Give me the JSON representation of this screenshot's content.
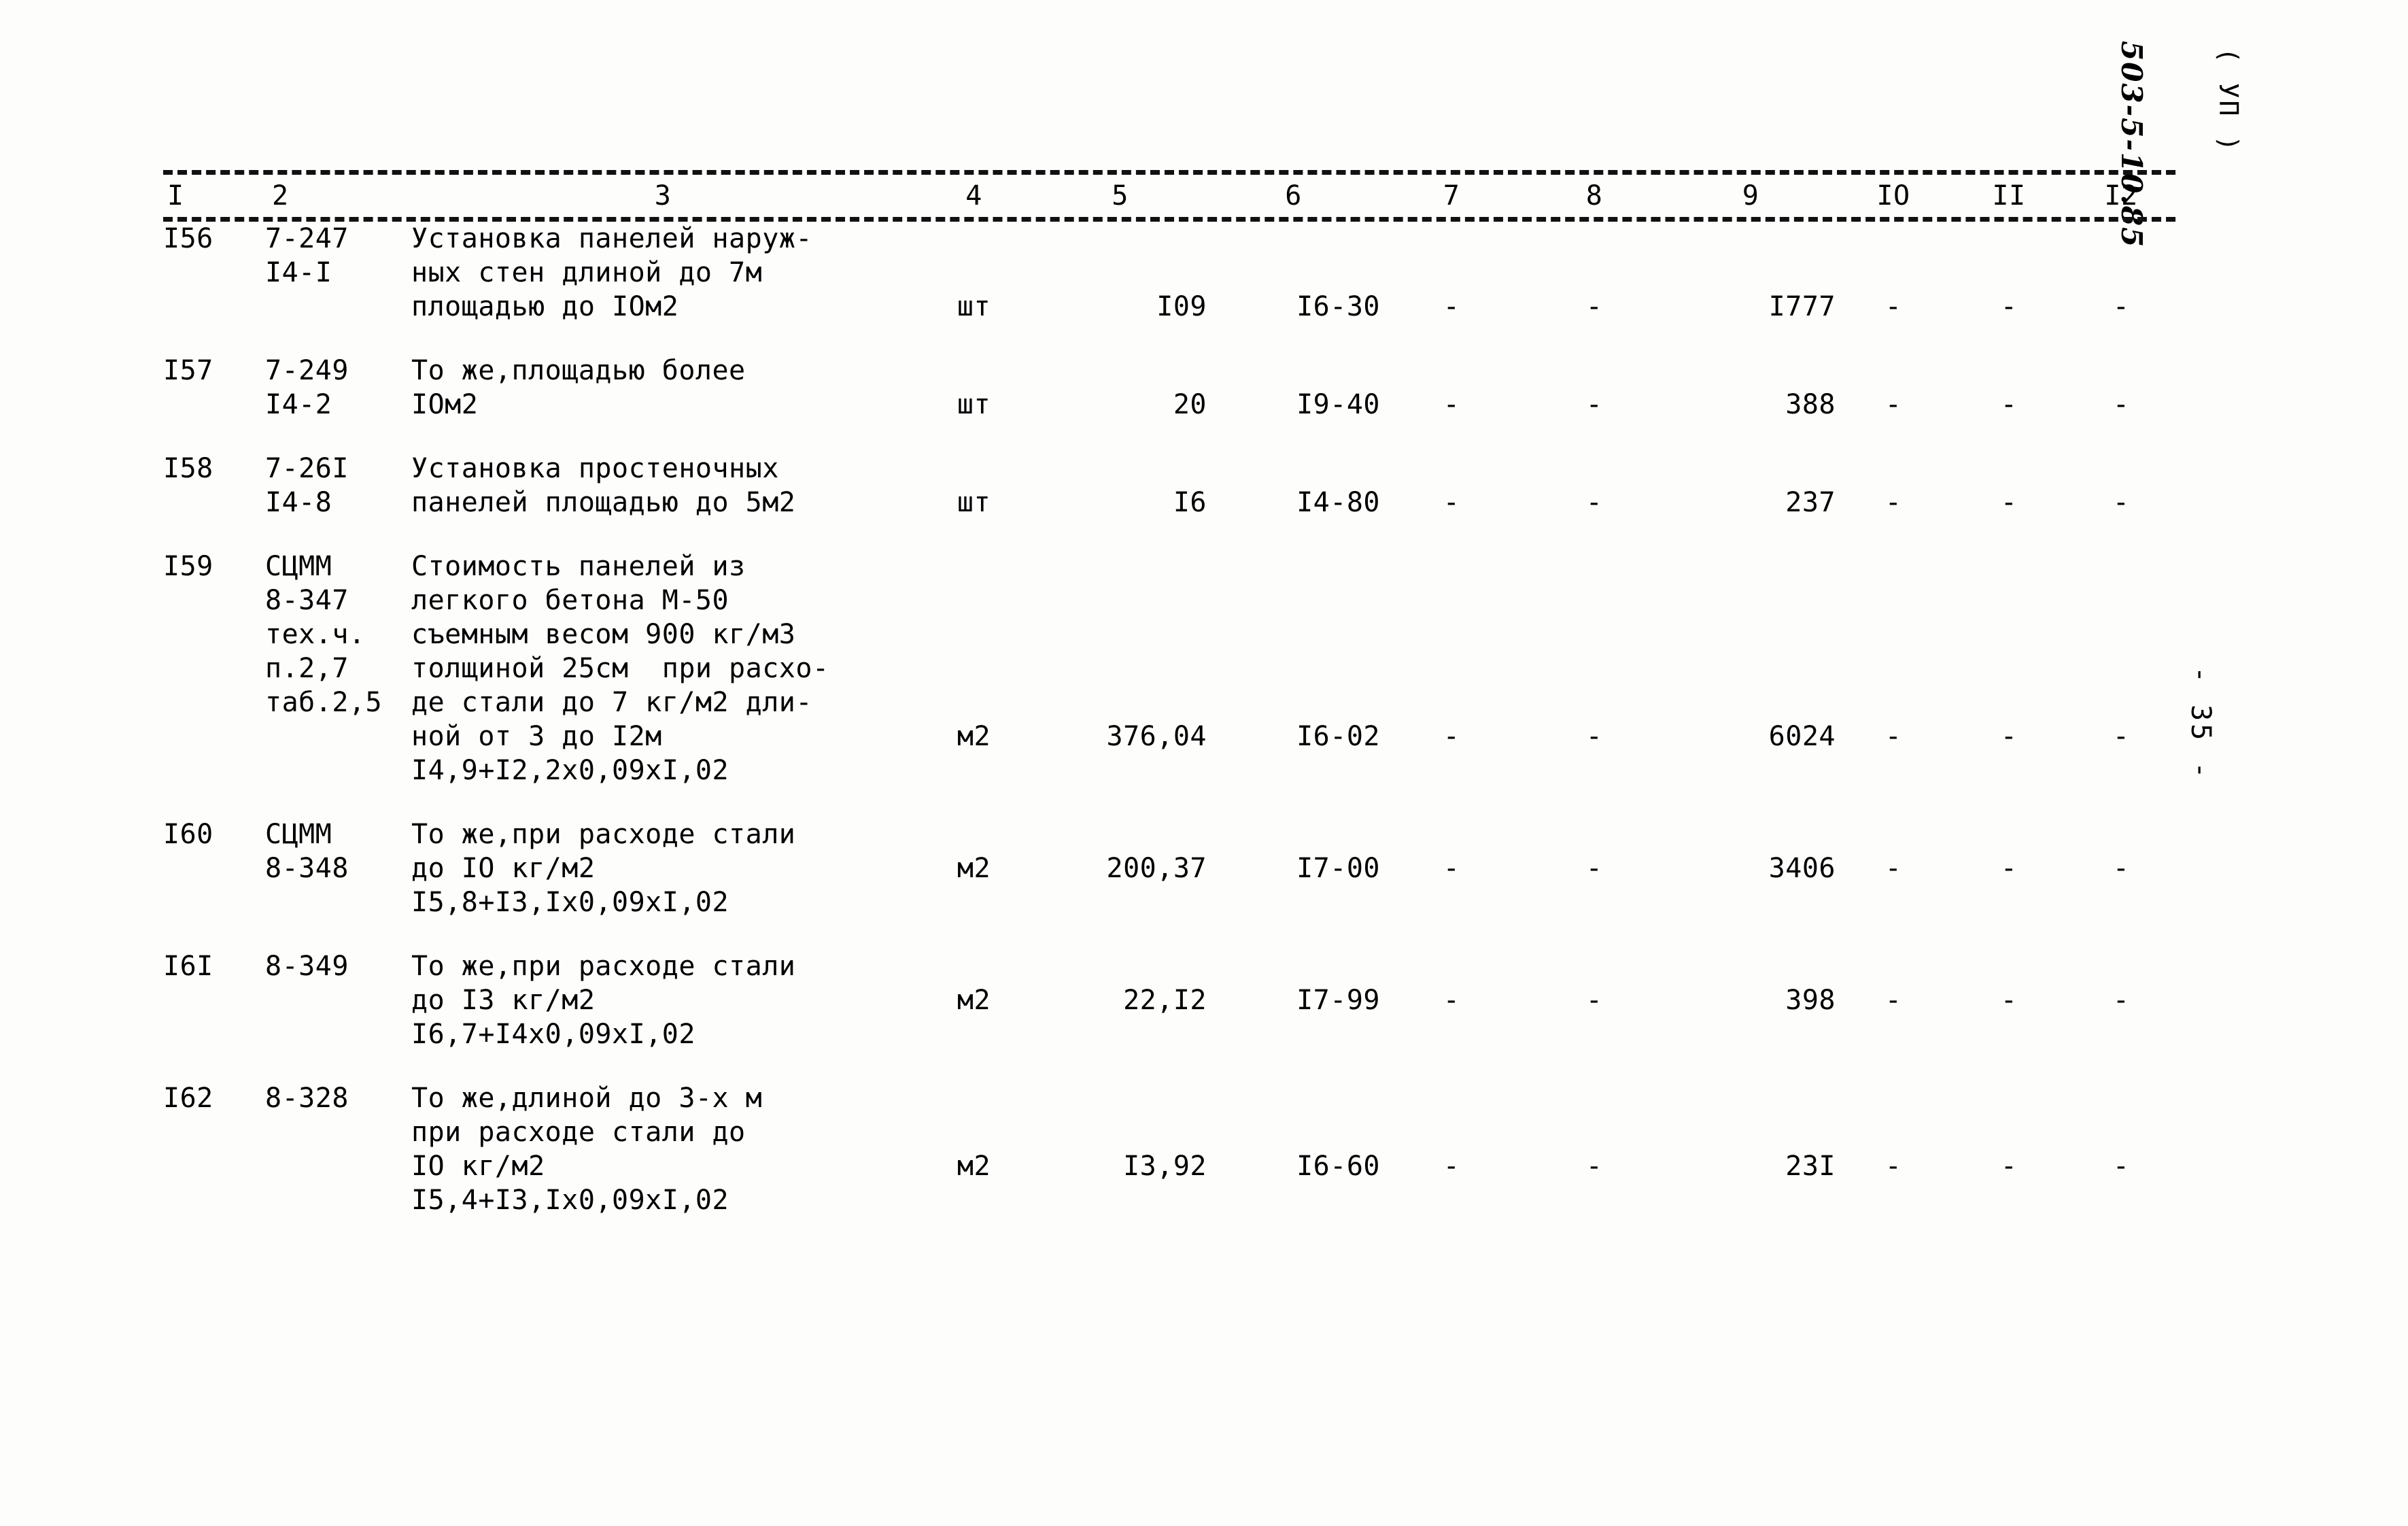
{
  "margin": {
    "document_code": "503-5-10.85",
    "variant": "( УП )",
    "page_number": "- 35 -"
  },
  "table": {
    "column_headers": [
      "I",
      "2",
      "3",
      "4",
      "5",
      "6",
      "7",
      "8",
      "9",
      "IO",
      "II",
      "I2"
    ],
    "rows": [
      {
        "num": "I56",
        "code": "7-247\nI4-I",
        "desc": "Установка панелей наруж-\nных стен длиной до 7м\nплощадью до IOм2",
        "unit": "шт",
        "qty": "I09",
        "price": "I6-30",
        "c7": "-",
        "c8": "-",
        "total": "I777",
        "c10": "-",
        "c11": "-",
        "c12": "-",
        "formula": "",
        "desc_lines_before_values": 2
      },
      {
        "num": "I57",
        "code": "7-249\nI4-2",
        "desc": "То же,площадью более\nIOм2",
        "unit": "шт",
        "qty": "20",
        "price": "I9-40",
        "c7": "-",
        "c8": "-",
        "total": "388",
        "c10": "-",
        "c11": "-",
        "c12": "-",
        "formula": "",
        "desc_lines_before_values": 1
      },
      {
        "num": "I58",
        "code": "7-26I\nI4-8",
        "desc": "Установка простеночных\nпанелей площадью до 5м2",
        "unit": "шт",
        "qty": "I6",
        "price": "I4-80",
        "c7": "-",
        "c8": "-",
        "total": "237",
        "c10": "-",
        "c11": "-",
        "c12": "-",
        "formula": "",
        "desc_lines_before_values": 1
      },
      {
        "num": "I59",
        "code": "СЦММ\n8-347\nтех.ч.\nп.2,7\nтаб.2,5",
        "desc": "Стоимость панелей из\nлегкого бетона М-50\nсъемным весом 900 кг/м3\nтолщиной 25см  при расхо-\nде стали до 7 кг/м2 дли-\nной от 3 до I2м",
        "unit": "м2",
        "qty": "376,04",
        "price": "I6-02",
        "c7": "-",
        "c8": "-",
        "total": "6024",
        "c10": "-",
        "c11": "-",
        "c12": "-",
        "formula": "I4,9+I2,2x0,09xI,02",
        "desc_lines_before_values": 5
      },
      {
        "num": "I60",
        "code": "СЦММ\n8-348",
        "desc": "То же,при расходе стали\nдо IO кг/м2",
        "unit": "м2",
        "qty": "200,37",
        "price": "I7-00",
        "c7": "-",
        "c8": "-",
        "total": "3406",
        "c10": "-",
        "c11": "-",
        "c12": "-",
        "formula": "I5,8+I3,Iх0,09хI,02",
        "desc_lines_before_values": 1
      },
      {
        "num": "I6I",
        "code": "8-349",
        "desc": "То же,при расходе стали\nдо I3 кг/м2",
        "unit": "м2",
        "qty": "22,I2",
        "price": "I7-99",
        "c7": "-",
        "c8": "-",
        "total": "398",
        "c10": "-",
        "c11": "-",
        "c12": "-",
        "formula": "I6,7+I4х0,09хI,02",
        "desc_lines_before_values": 1
      },
      {
        "num": "I62",
        "code": "8-328",
        "desc": "То же,длиной до 3-х м\nпри расходе стали до\nIO кг/м2",
        "unit": "м2",
        "qty": "I3,92",
        "price": "I6-60",
        "c7": "-",
        "c8": "-",
        "total": "23I",
        "c10": "-",
        "c11": "-",
        "c12": "-",
        "formula": "I5,4+I3,Iх0,09хI,02",
        "desc_lines_before_values": 2
      }
    ]
  }
}
